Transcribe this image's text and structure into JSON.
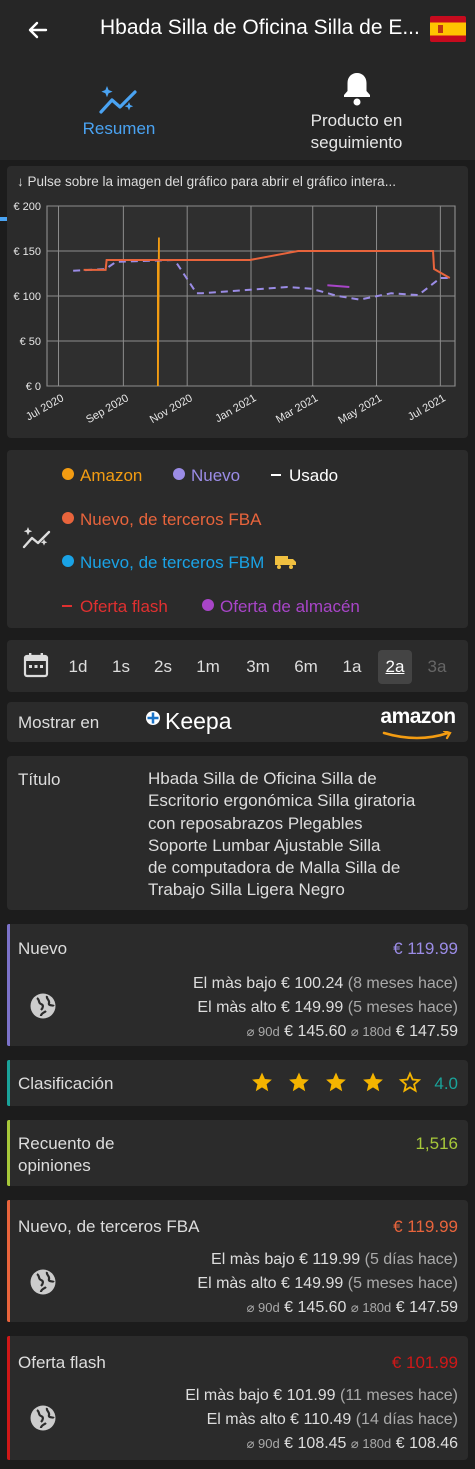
{
  "header": {
    "title": "Hbada Silla de Oficina Silla de E...",
    "flag": "es-flag-icon"
  },
  "tabs": [
    {
      "label": "Resumen",
      "icon": "trend-sparkle-icon",
      "active": true
    },
    {
      "label": "Producto en seguimiento",
      "line1": "Producto en",
      "line2": "seguimiento",
      "icon": "bell-icon",
      "active": false
    }
  ],
  "chart": {
    "hint": "↓ Pulse sobre la imagen del gráfico para abrir el gráfico intera..."
  },
  "chart_data": {
    "type": "line",
    "title": "",
    "ylabel": "",
    "xlabel": "",
    "ylim": [
      0,
      200
    ],
    "y_ticks": [
      "€ 200",
      "€ 150",
      "€ 100",
      "€ 50",
      "€ 0"
    ],
    "x_ticks": [
      "Jul 2020",
      "Sep 2020",
      "Nov 2020",
      "Jan 2021",
      "Mar 2021",
      "May 2021",
      "Jul 2021"
    ],
    "grid": true,
    "series": [
      {
        "name": "Amazon",
        "color": "#f39c12",
        "points": [
          [
            "2020-09-26",
            140
          ],
          [
            "2020-10-04",
            140
          ],
          [
            "2020-10-04",
            0
          ],
          [
            "2020-10-05",
            165
          ],
          [
            "2020-10-05",
            140
          ]
        ]
      },
      {
        "name": "Nuevo",
        "color": "#9b8ce6",
        "points": [
          [
            "2020-07-15",
            128
          ],
          [
            "2020-08-15",
            130
          ],
          [
            "2020-08-25",
            138
          ],
          [
            "2020-10-20",
            140
          ],
          [
            "2020-11-10",
            103
          ],
          [
            "2020-11-15",
            103
          ],
          [
            "2021-02-05",
            110
          ],
          [
            "2021-02-28",
            108
          ],
          [
            "2021-03-25",
            100
          ],
          [
            "2021-04-15",
            96
          ],
          [
            "2021-05-15",
            103
          ],
          [
            "2021-06-10",
            101
          ],
          [
            "2021-07-01",
            120
          ],
          [
            "2021-07-10",
            120
          ]
        ]
      },
      {
        "name": "Nuevo, de terceros FBA",
        "color": "#e8643c",
        "points": [
          [
            "2020-07-25",
            129
          ],
          [
            "2020-08-15",
            129
          ],
          [
            "2020-08-16",
            140
          ],
          [
            "2020-12-31",
            140
          ],
          [
            "2021-02-15",
            150
          ],
          [
            "2021-06-24",
            150
          ],
          [
            "2021-06-25",
            130
          ],
          [
            "2021-07-10",
            120
          ]
        ]
      },
      {
        "name": "Oferta de almacén",
        "color": "#a845c8",
        "points": [
          [
            "2021-03-15",
            112
          ],
          [
            "2021-04-05",
            110
          ]
        ]
      }
    ]
  },
  "legend": [
    {
      "label": "Amazon",
      "color": "#f39c12",
      "marker": "dot"
    },
    {
      "label": "Nuevo",
      "color": "#9b8ce6",
      "marker": "dot"
    },
    {
      "label": "Usado",
      "color": "#ffffff",
      "marker": "dash"
    },
    {
      "label": "Nuevo, de terceros FBA",
      "color": "#e8643c",
      "marker": "dot"
    },
    {
      "label": "Nuevo, de terceros FBM",
      "color": "#1aa3e6",
      "marker": "dot"
    },
    {
      "label": "Oferta flash",
      "color": "#e03030",
      "marker": "dash"
    },
    {
      "label": "Oferta de almacén",
      "color": "#a845c8",
      "marker": "dot"
    }
  ],
  "ranges": [
    {
      "label": "1d"
    },
    {
      "label": "1s"
    },
    {
      "label": "2s"
    },
    {
      "label": "1m"
    },
    {
      "label": "3m"
    },
    {
      "label": "6m"
    },
    {
      "label": "1a"
    },
    {
      "label": "2a",
      "active": true
    },
    {
      "label": "3a",
      "disabled": true
    }
  ],
  "show_in": {
    "label": "Mostrar en",
    "keepa": "Keepa",
    "amazon": "amazon"
  },
  "title_card": {
    "label": "Título",
    "lines": [
      "Hbada Silla de Oficina Silla de",
      "Escritorio ergonómica Silla giratoria",
      "con reposabrazos Plegables",
      "Soporte Lumbar Ajustable Silla",
      "de computadora de Malla Silla de",
      "Trabajo Silla Ligera Negro"
    ]
  },
  "nuevo": {
    "label": "Nuevo",
    "price": "€ 119.99",
    "price_color": "#9b8ce6",
    "accent": "#7b72c9",
    "low_label": "El màs bajo",
    "low_value": "€ 100.24",
    "low_when": "(8 meses hace)",
    "high_label": "El màs alto",
    "high_value": "€ 149.99",
    "high_when": "(5 meses hace)",
    "avg90_label": "⌀ 90d",
    "avg90_value": "€ 145.60",
    "avg180_label": "⌀ 180d",
    "avg180_value": "€ 147.59"
  },
  "rating": {
    "label": "Clasificación",
    "value": "4.0",
    "stars": 4,
    "max_stars": 5,
    "accent": "#1aa39a"
  },
  "reviews": {
    "label_line1": "Recuento de",
    "label_line2": "opiniones",
    "value": "1,516",
    "accent": "#a7c83a"
  },
  "fba": {
    "label": "Nuevo, de terceros FBA",
    "price": "€ 119.99",
    "price_color": "#e8643c",
    "accent": "#e8643c",
    "low_label": "El màs bajo",
    "low_value": "€ 119.99",
    "low_when": "(5 días hace)",
    "high_label": "El màs alto",
    "high_value": "€ 149.99",
    "high_when": "(5 meses hace)",
    "avg90_label": "⌀ 90d",
    "avg90_value": "€ 145.60",
    "avg180_label": "⌀ 180d",
    "avg180_value": "€ 147.59"
  },
  "flash": {
    "label": "Oferta flash",
    "price": "€ 101.99",
    "price_color": "#d01818",
    "accent": "#d01818",
    "low_label": "El màs bajo",
    "low_value": "€ 101.99",
    "low_when": "(11 meses hace)",
    "high_label": "El màs alto",
    "high_value": "€ 110.49",
    "high_when": "(14 días hace)",
    "avg90_label": "⌀ 90d",
    "avg90_value": "€ 108.45",
    "avg180_label": "⌀ 180d",
    "avg180_value": "€ 108.46"
  }
}
